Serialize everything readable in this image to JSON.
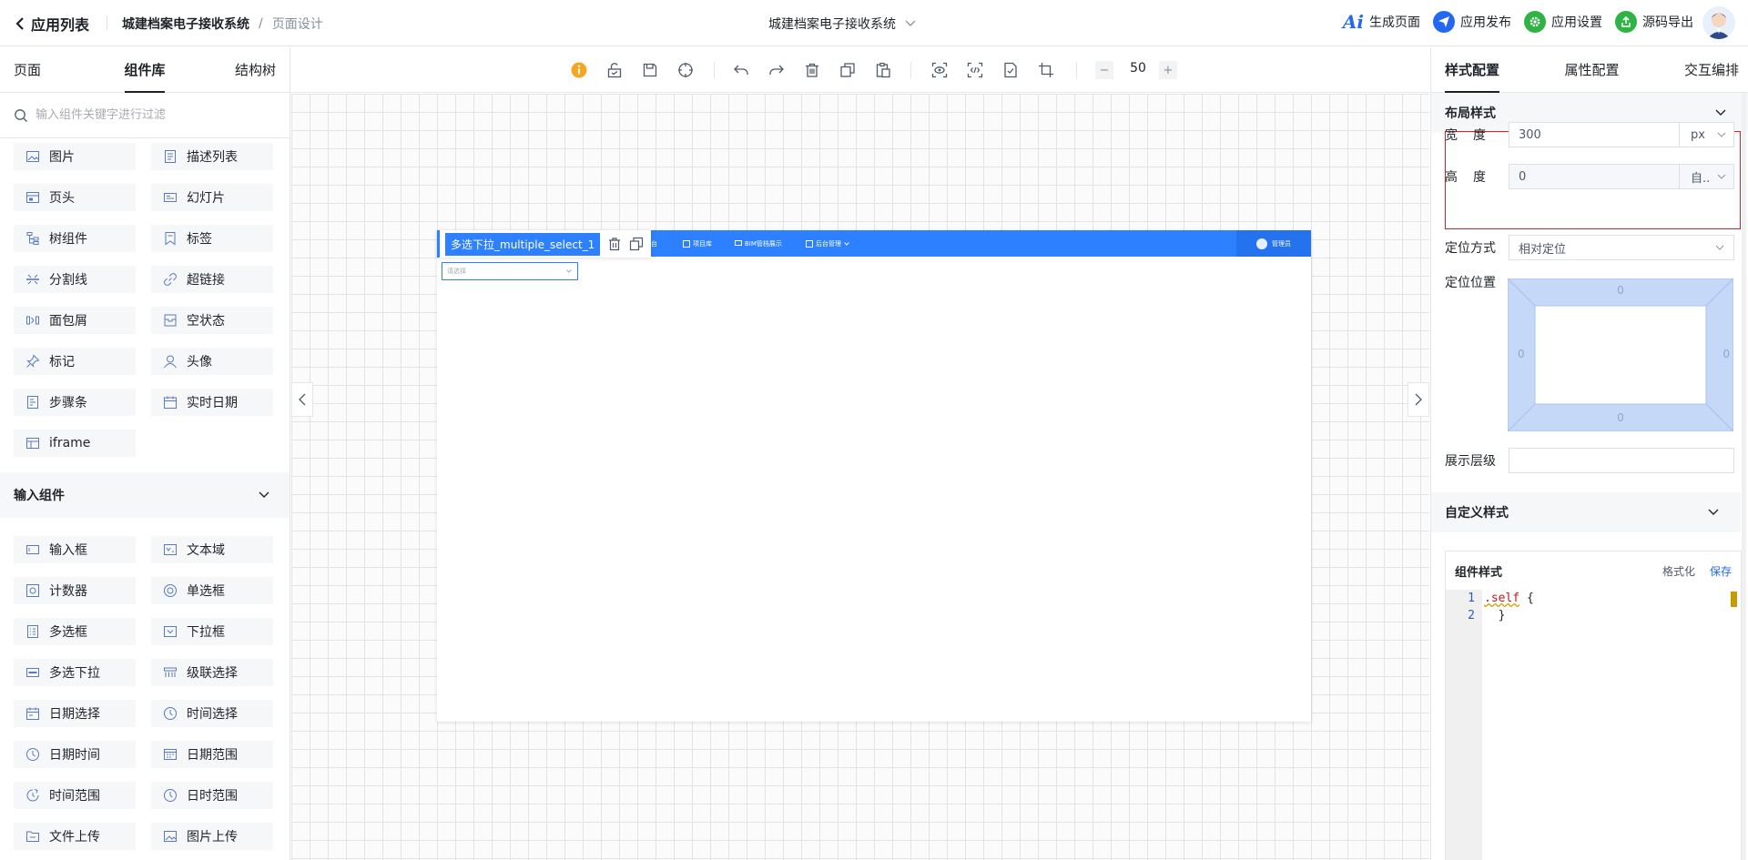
{
  "header": {
    "back_label": "应用列表",
    "breadcrumb": {
      "app": "城建档案电子接收系统",
      "separator": "/",
      "page": "页面设计"
    },
    "center_title": "城建档案电子接收系统",
    "actions": [
      {
        "label": "生成页面",
        "icon": "ai-icon"
      },
      {
        "label": "应用发布",
        "icon": "send-icon",
        "color": "#2468f2"
      },
      {
        "label": "应用设置",
        "icon": "gear-icon",
        "color": "#2fb344"
      },
      {
        "label": "源码导出",
        "icon": "export-icon",
        "color": "#2fb344"
      }
    ]
  },
  "left_panel": {
    "tabs": [
      "页面",
      "组件库",
      "结构树"
    ],
    "active_tab": "组件库",
    "search_placeholder": "输入组件关键字进行过滤",
    "basic_components": [
      {
        "label": "图片",
        "icon": "image-icon"
      },
      {
        "label": "描述列表",
        "icon": "description-list-icon"
      },
      {
        "label": "页头",
        "icon": "page-header-icon"
      },
      {
        "label": "幻灯片",
        "icon": "carousel-icon"
      },
      {
        "label": "树组件",
        "icon": "tree-icon"
      },
      {
        "label": "标签",
        "icon": "tag-icon"
      },
      {
        "label": "分割线",
        "icon": "divider-icon"
      },
      {
        "label": "超链接",
        "icon": "link-icon"
      },
      {
        "label": "面包屑",
        "icon": "breadcrumb-icon"
      },
      {
        "label": "空状态",
        "icon": "empty-icon"
      },
      {
        "label": "标记",
        "icon": "pin-icon"
      },
      {
        "label": "头像",
        "icon": "user-icon"
      },
      {
        "label": "步骤条",
        "icon": "steps-icon"
      },
      {
        "label": "实时日期",
        "icon": "calendar-icon"
      },
      {
        "label": "iframe",
        "icon": "iframe-icon"
      }
    ],
    "input_section_title": "输入组件",
    "input_components": [
      {
        "label": "输入框",
        "icon": "input-icon"
      },
      {
        "label": "文本域",
        "icon": "textarea-icon"
      },
      {
        "label": "计数器",
        "icon": "counter-icon"
      },
      {
        "label": "单选框",
        "icon": "radio-icon"
      },
      {
        "label": "多选框",
        "icon": "checkbox-icon"
      },
      {
        "label": "下拉框",
        "icon": "select-icon"
      },
      {
        "label": "多选下拉",
        "icon": "multi-select-icon"
      },
      {
        "label": "级联选择",
        "icon": "cascader-icon"
      },
      {
        "label": "日期选择",
        "icon": "calendar-icon"
      },
      {
        "label": "时间选择",
        "icon": "clock-icon"
      },
      {
        "label": "日期时间",
        "icon": "clock-icon"
      },
      {
        "label": "日期范围",
        "icon": "calendar-range-icon"
      },
      {
        "label": "时间范围",
        "icon": "clock-range-icon"
      },
      {
        "label": "日时范围",
        "icon": "clock-icon"
      },
      {
        "label": "文件上传",
        "icon": "file-upload-icon"
      },
      {
        "label": "图片上传",
        "icon": "image-upload-icon"
      }
    ]
  },
  "toolbar": {
    "zoom_minus": "−",
    "zoom_value": "50",
    "zoom_plus": "+"
  },
  "canvas": {
    "nav_items": [
      "作台",
      "项目库",
      "BIM管档展示",
      "后台管理"
    ],
    "user_label": "管理员",
    "selected_component": "多选下拉_multiple_select_1",
    "select_placeholder": "请选择"
  },
  "right_panel": {
    "tabs": [
      "样式配置",
      "属性配置",
      "交互编排"
    ],
    "active_tab": "样式配置",
    "layout_section": "布局样式",
    "width": {
      "label_a": "宽",
      "label_b": "度",
      "value": "300",
      "unit": "px"
    },
    "height": {
      "label_a": "高",
      "label_b": "度",
      "value": "0",
      "unit": "自.."
    },
    "position_mode": {
      "label": "定位方式",
      "value": "相对定位"
    },
    "position": {
      "label": "定位位置",
      "top": "0",
      "right": "0",
      "bottom": "0",
      "left": "0"
    },
    "z_index": {
      "label": "展示层级",
      "value": ""
    },
    "custom_section": "自定义样式",
    "style_card": {
      "title": "组件样式",
      "format_label": "格式化",
      "save_label": "保存",
      "line_numbers": [
        "1",
        "2"
      ],
      "code_line1_selector": ".self",
      "code_line1_rest": " {",
      "code_line2": "  }"
    }
  },
  "colors": {
    "accent": "#2d80ff",
    "link": "#2468f2",
    "highlight_border": "#e02020"
  }
}
